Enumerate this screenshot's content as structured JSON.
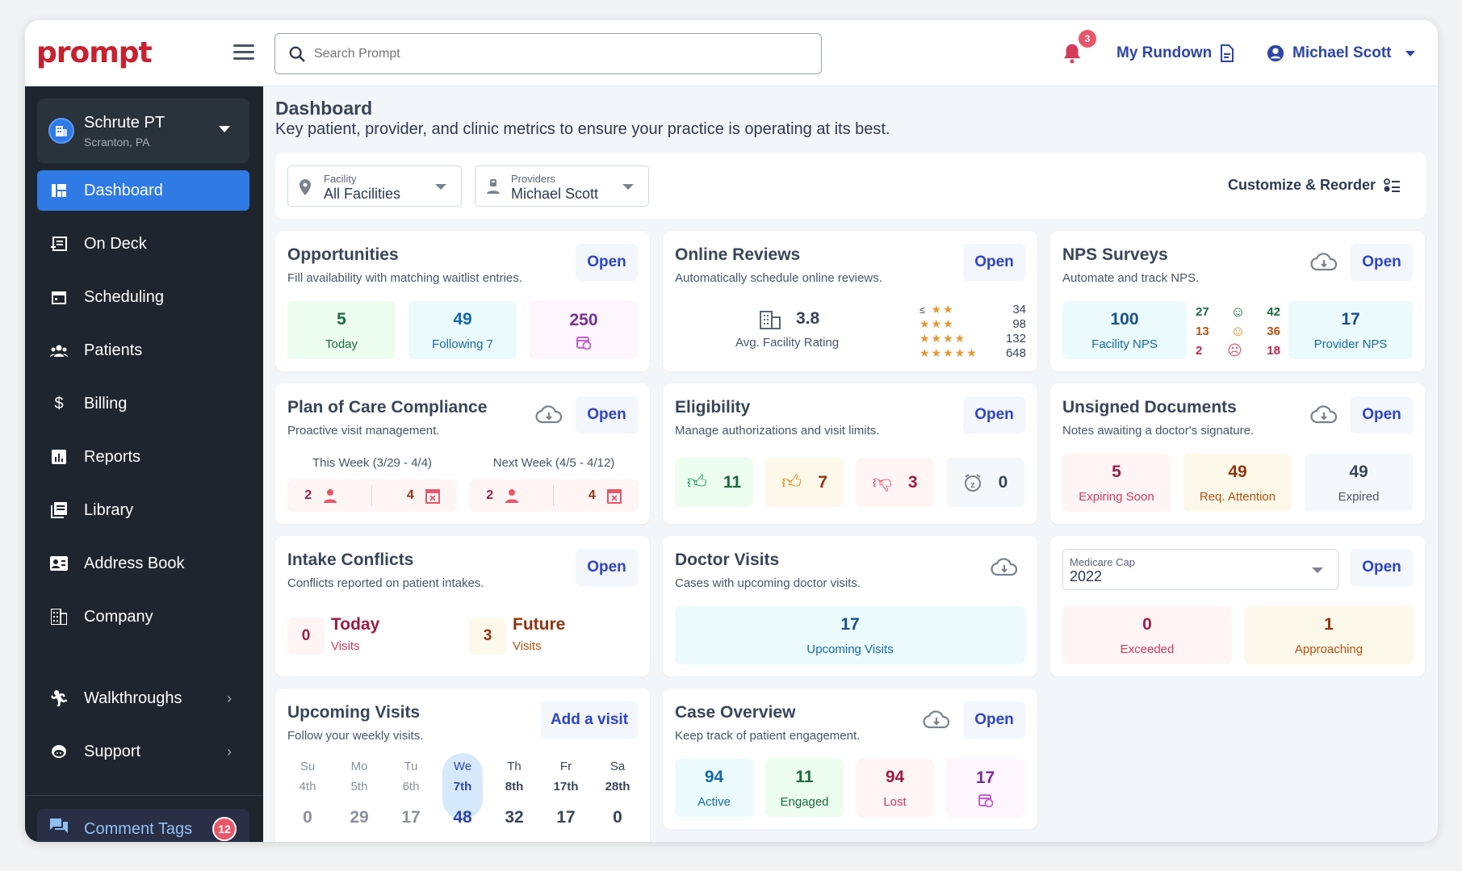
{
  "app": {
    "logo": "prompt"
  },
  "header": {
    "search_placeholder": "Search Prompt",
    "notification_count": "3",
    "rundown_label": "My Rundown",
    "user_name": "Michael Scott"
  },
  "sidebar": {
    "facility_name": "Schrute PT",
    "facility_location": "Scranton, PA",
    "items": [
      {
        "label": "Dashboard",
        "icon": "dashboard-icon",
        "active": true
      },
      {
        "label": "On Deck",
        "icon": "on-deck-icon"
      },
      {
        "label": "Scheduling",
        "icon": "calendar-icon"
      },
      {
        "label": "Patients",
        "icon": "patients-icon"
      },
      {
        "label": "Billing",
        "icon": "dollar-icon"
      },
      {
        "label": "Reports",
        "icon": "reports-icon"
      },
      {
        "label": "Library",
        "icon": "library-icon"
      },
      {
        "label": "Address Book",
        "icon": "address-book-icon"
      },
      {
        "label": "Company",
        "icon": "company-icon"
      },
      {
        "label": "Walkthroughs",
        "icon": "walkthroughs-icon"
      },
      {
        "label": "Support",
        "icon": "support-icon"
      }
    ],
    "comment_tags": {
      "label": "Comment Tags",
      "count": "12"
    }
  },
  "page": {
    "title": "Dashboard",
    "subtitle": "Key patient, provider, and clinic metrics to ensure your practice is operating at its best.",
    "filters": {
      "facility": {
        "label": "Facility",
        "value": "All Facilities"
      },
      "providers": {
        "label": "Providers",
        "value": "Michael Scott"
      },
      "customize_label": "Customize & Reorder"
    }
  },
  "open_label": "Open",
  "cards": {
    "opportunities": {
      "title": "Opportunities",
      "subtitle": "Fill availability with matching waitlist entries.",
      "tiles": [
        {
          "n": "5",
          "l": "Today"
        },
        {
          "n": "49",
          "l": "Following 7"
        },
        {
          "n": "250",
          "l": ""
        }
      ]
    },
    "reviews": {
      "title": "Online Reviews",
      "subtitle": "Automatically schedule online reviews.",
      "rating": "3.8",
      "rating_label": "Avg. Facility Rating",
      "breakdown": [
        {
          "stars": "≤2",
          "count": "34"
        },
        {
          "stars": "3",
          "count": "98"
        },
        {
          "stars": "4",
          "count": "132"
        },
        {
          "stars": "5",
          "count": "648"
        }
      ]
    },
    "nps": {
      "title": "NPS Surveys",
      "subtitle": "Automate and track NPS.",
      "facility_nps": "100",
      "facility_label": "Facility NPS",
      "provider_nps": "17",
      "provider_label": "Provider NPS",
      "promoters": [
        "27",
        "42"
      ],
      "passives": [
        "13",
        "36"
      ],
      "detractors": [
        "2",
        "18"
      ]
    },
    "poc": {
      "title": "Plan of Care Compliance",
      "subtitle": "Proactive visit management.",
      "this_week": {
        "label": "This Week (3/29 - 4/4)",
        "patients": "2",
        "visits": "4"
      },
      "next_week": {
        "label": "Next Week (4/5 - 4/12)",
        "patients": "2",
        "visits": "4"
      }
    },
    "eligibility": {
      "title": "Eligibility",
      "subtitle": "Manage authorizations and visit limits.",
      "approved": "11",
      "partial": "7",
      "denied": "3",
      "pending": "0"
    },
    "unsigned": {
      "title": "Unsigned Documents",
      "subtitle": "Notes awaiting a doctor's signature.",
      "tiles": [
        {
          "n": "5",
          "l": "Expiring Soon"
        },
        {
          "n": "49",
          "l": "Req. Attention"
        },
        {
          "n": "49",
          "l": "Expired"
        }
      ]
    },
    "intake": {
      "title": "Intake Conflicts",
      "subtitle": "Conflicts reported on patient intakes.",
      "today": {
        "n": "0",
        "t": "Today",
        "l": "Visits"
      },
      "future": {
        "n": "3",
        "t": "Future",
        "l": "Visits"
      }
    },
    "doctor": {
      "title": "Doctor Visits",
      "subtitle": "Cases with upcoming doctor visits.",
      "count": "17",
      "label": "Upcoming Visits"
    },
    "medicare": {
      "select_label": "Medicare Cap",
      "select_value": "2022",
      "tiles": [
        {
          "n": "0",
          "l": "Exceeded"
        },
        {
          "n": "1",
          "l": "Approaching"
        }
      ]
    },
    "upcoming": {
      "title": "Upcoming Visits",
      "subtitle": "Follow your weekly visits.",
      "add_label": "Add a visit",
      "days": [
        {
          "d": "Su",
          "date": "4th",
          "n": "0"
        },
        {
          "d": "Mo",
          "date": "5th",
          "n": "29"
        },
        {
          "d": "Tu",
          "date": "6th",
          "n": "17"
        },
        {
          "d": "We",
          "date": "7th",
          "n": "48",
          "selected": true
        },
        {
          "d": "Th",
          "date": "8th",
          "n": "32"
        },
        {
          "d": "Fr",
          "date": "17th",
          "n": "17"
        },
        {
          "d": "Sa",
          "date": "28th",
          "n": "0"
        }
      ]
    },
    "case": {
      "title": "Case Overview",
      "subtitle": "Keep track of patient engagement.",
      "tiles": [
        {
          "n": "94",
          "l": "Active"
        },
        {
          "n": "11",
          "l": "Engaged"
        },
        {
          "n": "94",
          "l": "Lost"
        },
        {
          "n": "17",
          "l": ""
        }
      ]
    }
  }
}
